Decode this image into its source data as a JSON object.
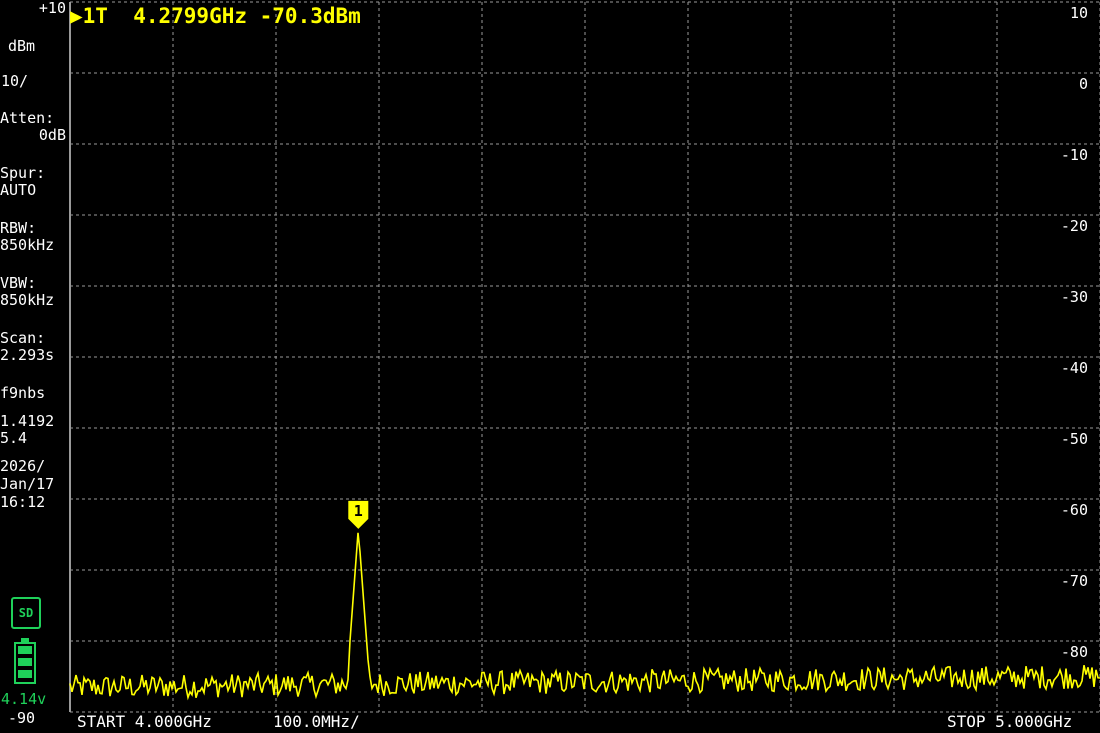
{
  "marker_readout": "▶1T  4.2799GHz -70.3dBm",
  "left_panel": {
    "ref_level": "+10",
    "unit": "dBm",
    "scale": "10/",
    "atten_label": "Atten:",
    "atten_value": "0dB",
    "spur_label": "Spur:",
    "spur_value": "AUTO",
    "rbw_label": "RBW:",
    "rbw_value": "850kHz",
    "vbw_label": "VBW:",
    "vbw_value": "850kHz",
    "scan_label": "Scan:",
    "scan_value": "2.293s",
    "user": "f9nbs",
    "version_1": "1.4192",
    "version_2": "5.4",
    "date_year": "2026/",
    "date_day": "Jan/17",
    "time": "16:12",
    "sd_label": "SD",
    "battery_voltage": "4.14v",
    "bottom_level": "-90"
  },
  "y_labels": [
    "10",
    "0",
    "-10",
    "-20",
    "-30",
    "-40",
    "-50",
    "-60",
    "-70",
    "-80"
  ],
  "footer": {
    "start": "START 4.000GHz",
    "span_per_div": "100.0MHz/",
    "stop": "STOP 5.000GHz"
  },
  "marker": {
    "id": "1",
    "freq_ghz": 4.2799,
    "level_dbm": -70.3
  },
  "chart_data": {
    "type": "line",
    "x_range_ghz": [
      4.0,
      5.0
    ],
    "ylim": [
      -90,
      10
    ],
    "y_ticks": [
      10,
      0,
      -10,
      -20,
      -30,
      -40,
      -50,
      -60,
      -70,
      -80
    ],
    "grid": true,
    "noise_floor_dbm": [
      -86.5,
      -85
    ],
    "peak": {
      "x": 4.2799,
      "y": -64.2
    },
    "trace_color": "#ffff00"
  },
  "colors": {
    "trace": "#ffff00",
    "grid": "#9a9a9a",
    "status": "#1fd15a"
  }
}
